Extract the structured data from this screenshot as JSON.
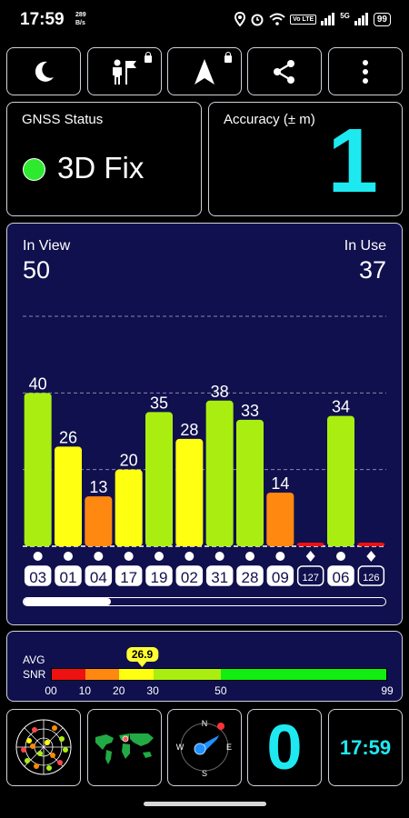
{
  "status_bar": {
    "time": "17:59",
    "net_rate_value": "289",
    "net_rate_unit": "B/s",
    "volte": "Vo LTE",
    "network": "5G",
    "battery": "99"
  },
  "toolbar": [
    {
      "icon": "moon-icon",
      "locked": false
    },
    {
      "icon": "person-flag-icon",
      "locked": true
    },
    {
      "icon": "navigation-arrow-icon",
      "locked": true
    },
    {
      "icon": "share-icon",
      "locked": false
    },
    {
      "icon": "more-vertical-icon",
      "locked": false
    }
  ],
  "gnss_status": {
    "label": "GNSS Status",
    "value": "3D Fix",
    "color": "#2eea2e"
  },
  "accuracy": {
    "label": "Accuracy (± m)",
    "value": "1",
    "color": "#1ee9f0"
  },
  "satellites": {
    "in_view_label": "In View",
    "in_view": "50",
    "in_use_label": "In Use",
    "in_use": "37"
  },
  "chart_data": {
    "type": "bar",
    "categories": [
      "03",
      "01",
      "04",
      "17",
      "19",
      "02",
      "31",
      "28",
      "09",
      "127",
      "06",
      "126"
    ],
    "values": [
      40,
      26,
      13,
      20,
      35,
      28,
      38,
      33,
      14,
      0,
      34,
      0
    ],
    "labels_shown": [
      true,
      true,
      true,
      true,
      true,
      true,
      true,
      true,
      true,
      false,
      true,
      false
    ],
    "markers": [
      "circle",
      "circle",
      "circle",
      "circle",
      "circle",
      "circle",
      "circle",
      "circle",
      "circle",
      "diamond",
      "circle",
      "diamond"
    ],
    "boxed_style": [
      "pill",
      "pill",
      "pill",
      "pill",
      "pill",
      "pill",
      "pill",
      "pill",
      "pill",
      "outline",
      "pill",
      "outline"
    ],
    "ylim": [
      0,
      60
    ],
    "grid_values": [
      20,
      40
    ],
    "colors": {
      "red": "#ee1111",
      "orange": "#ff8811",
      "yellow": "#ffff11",
      "lime": "#aaee11"
    }
  },
  "scroll_position": 0.24,
  "snr": {
    "label_line1": "AVG",
    "label_line2": "SNR",
    "average": "26.9",
    "average_value": 26.9,
    "scale_max": 99,
    "ticks": [
      "00",
      "10",
      "20",
      "30",
      "50",
      "99"
    ],
    "tick_values": [
      0,
      10,
      20,
      30,
      50,
      99
    ],
    "segments": [
      {
        "from": 0,
        "to": 10,
        "color": "#ee1111"
      },
      {
        "from": 10,
        "to": 20,
        "color": "#ff8811"
      },
      {
        "from": 20,
        "to": 30,
        "color": "#ffff11"
      },
      {
        "from": 30,
        "to": 50,
        "color": "#aaee11"
      },
      {
        "from": 50,
        "to": 99,
        "color": "#11ee11"
      }
    ]
  },
  "bottom_tiles": {
    "compass": {
      "n": "N",
      "s": "S",
      "e": "E",
      "w": "W"
    },
    "satellites_in_use_count": "0",
    "clock": "17:59"
  }
}
